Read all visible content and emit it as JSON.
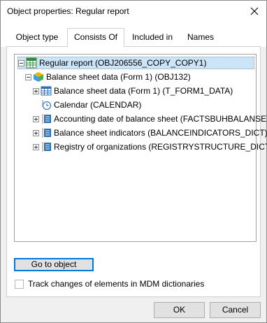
{
  "window": {
    "title": "Object properties: Regular report"
  },
  "tabs": [
    {
      "label": "Object type",
      "active": false
    },
    {
      "label": "Consists Of",
      "active": true
    },
    {
      "label": "Included in",
      "active": false
    },
    {
      "label": "Names",
      "active": false
    }
  ],
  "tree": {
    "nodes": [
      {
        "label": "Regular report (OBJ206556_COPY_COPY1)",
        "icon": "regular-report-icon",
        "expander": "minus",
        "selected": true
      },
      {
        "label": "Balance sheet data (Form 1) (OBJ132)",
        "icon": "cube-icon",
        "expander": "minus",
        "selected": false
      },
      {
        "label": "Balance sheet data (Form 1) (T_FORM1_DATA)",
        "icon": "table-icon",
        "expander": "plus",
        "selected": false
      },
      {
        "label": "Calendar (CALENDAR)",
        "icon": "calendar-icon",
        "expander": "none",
        "selected": false
      },
      {
        "label": "Accounting date of balance sheet  (FACTSBUHBALANSE)",
        "icon": "dictionary-icon",
        "expander": "plus",
        "selected": false
      },
      {
        "label": "Balance sheet indicators (BALANCEINDICATORS_DICT)",
        "icon": "dictionary-icon",
        "expander": "plus",
        "selected": false
      },
      {
        "label": "Registry of organizations (REGISTRYSTRUCTURE_DICT)",
        "icon": "dictionary-icon",
        "expander": "plus",
        "selected": false
      }
    ]
  },
  "buttons": {
    "go_to_object": "Go to object",
    "ok": "OK",
    "cancel": "Cancel"
  },
  "track_changes": {
    "label": "Track changes of elements in MDM dictionaries",
    "checked": false
  }
}
